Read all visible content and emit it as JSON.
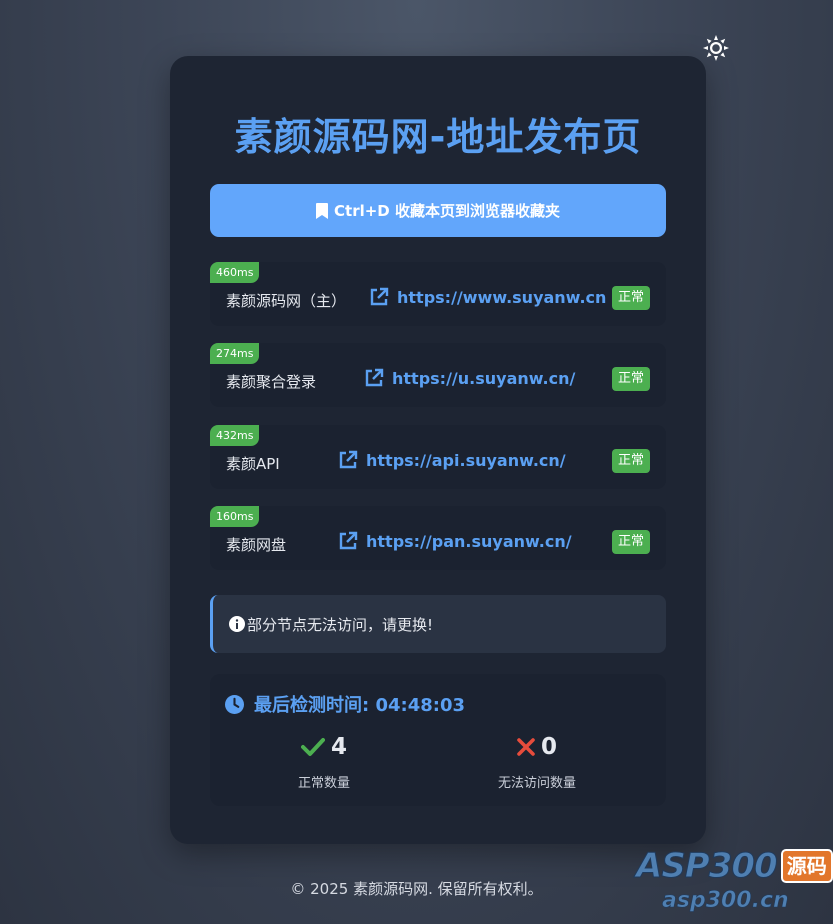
{
  "page": {
    "title": "素颜源码网-地址发布页",
    "bookmark_label": "Ctrl+D 收藏本页到浏览器收藏夹"
  },
  "links": [
    {
      "latency": "460ms",
      "name": "素颜源码网（主）",
      "url": "https://www.suyanw.cn",
      "status": "正常"
    },
    {
      "latency": "274ms",
      "name": "素颜聚合登录",
      "url": "https://u.suyanw.cn/",
      "status": "正常"
    },
    {
      "latency": "432ms",
      "name": "素颜API",
      "url": "https://api.suyanw.cn/",
      "status": "正常"
    },
    {
      "latency": "160ms",
      "name": "素颜网盘",
      "url": "https://pan.suyanw.cn/",
      "status": "正常"
    }
  ],
  "notice": "部分节点无法访问，请更换!",
  "stats": {
    "check_time": "最后检测时间: 04:48:03",
    "normal_count": "4",
    "normal_label": "正常数量",
    "fail_count": "0",
    "fail_label": "无法访问数量"
  },
  "footer": "© 2025 素颜源码网. 保留所有权利。",
  "watermark": {
    "brand": "ASP300",
    "tag": "源码",
    "url": "asp300.cn"
  },
  "icons": {
    "theme": "sun-icon",
    "bookmark": "bookmark-icon",
    "link": "external-link-icon",
    "info": "info-icon",
    "clock": "clock-icon",
    "check": "check-icon",
    "cross": "cross-icon"
  },
  "colors": {
    "accent": "#5ba0f2",
    "button": "#62a6fb",
    "success": "#4caf50",
    "danger": "#e74c3c",
    "card": "#1e2533"
  }
}
